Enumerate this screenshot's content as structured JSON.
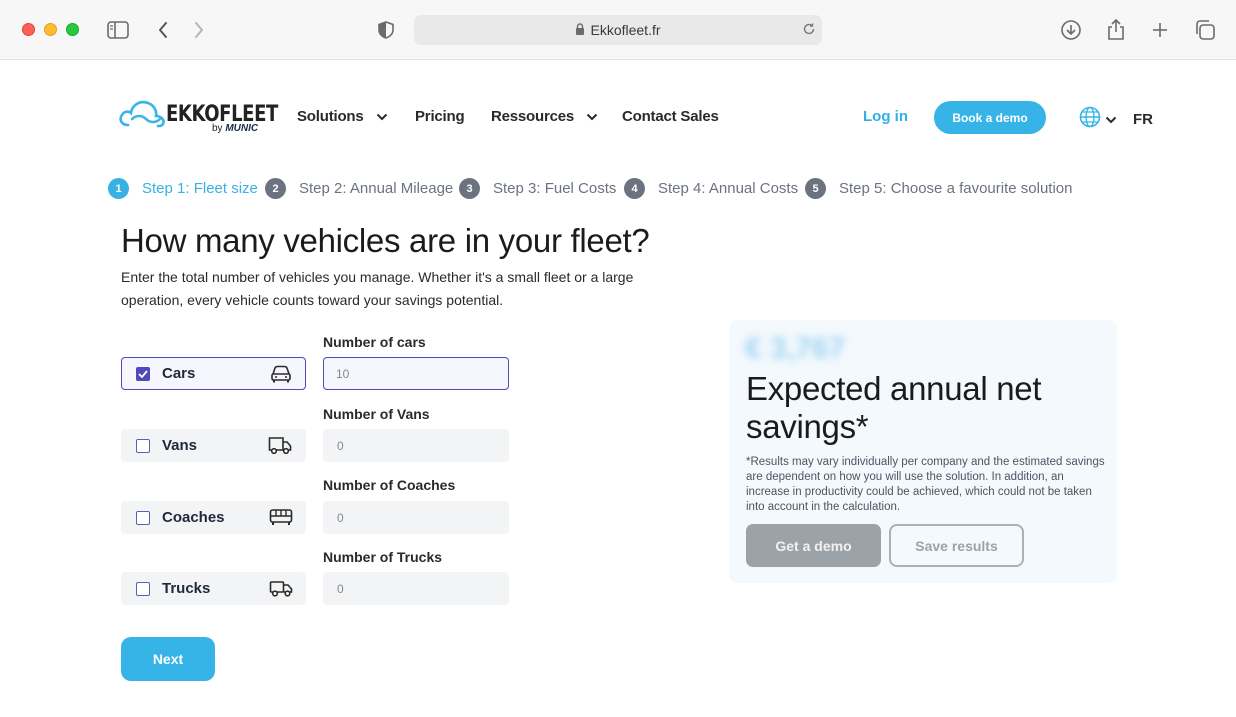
{
  "browser": {
    "url": "Ekkofleet.fr"
  },
  "header": {
    "logo_text": "EKKOFLEET",
    "logo_by": "by",
    "logo_brand": "MUNIC",
    "nav": [
      {
        "label": "Solutions"
      },
      {
        "label": "Pricing"
      },
      {
        "label": "Ressources"
      },
      {
        "label": "Contact Sales"
      }
    ],
    "login_label": "Log in",
    "demo_label": "Book a demo",
    "lang_label": "FR"
  },
  "steps": [
    {
      "number": "1",
      "label": "Step 1: Fleet size",
      "active": true
    },
    {
      "number": "2",
      "label": "Step 2: Annual Mileage",
      "active": false
    },
    {
      "number": "3",
      "label": "Step 3: Fuel Costs",
      "active": false
    },
    {
      "number": "4",
      "label": "Step 4: Annual Costs",
      "active": false
    },
    {
      "number": "5",
      "label": "Step 5: Choose a favourite solution",
      "active": false
    }
  ],
  "main": {
    "heading": "How many vehicles are in your fleet?",
    "intro": "Enter the total number of vehicles you manage. Whether it's a small fleet or a large operation, every vehicle counts toward your savings potential.",
    "vehicles": [
      {
        "label": "Cars",
        "checked": true,
        "icon": "car-icon",
        "field_label": "Number of cars",
        "placeholder": "10"
      },
      {
        "label": "Vans",
        "checked": false,
        "icon": "van-icon",
        "field_label": "Number of Vans",
        "placeholder": "0"
      },
      {
        "label": "Coaches",
        "checked": false,
        "icon": "bus-icon",
        "field_label": "Number of Coaches",
        "placeholder": "0"
      },
      {
        "label": "Trucks",
        "checked": false,
        "icon": "truck-icon",
        "field_label": "Number of Trucks",
        "placeholder": "0"
      }
    ],
    "next_label": "Next"
  },
  "savings_card": {
    "amount": "€ 3,767",
    "title": "Expected annual net savings*",
    "note": "*Results may vary individually per company and the estimated savings are dependent on how you will use the solution. In addition, an increase in productivity could be achieved, which could not be taken into account in the calculation.",
    "demo_label": "Get a demo",
    "save_label": "Save results"
  },
  "colors": {
    "accent": "#36b4e8",
    "checkbox": "#5148b9",
    "step_inactive": "#6b7280"
  }
}
